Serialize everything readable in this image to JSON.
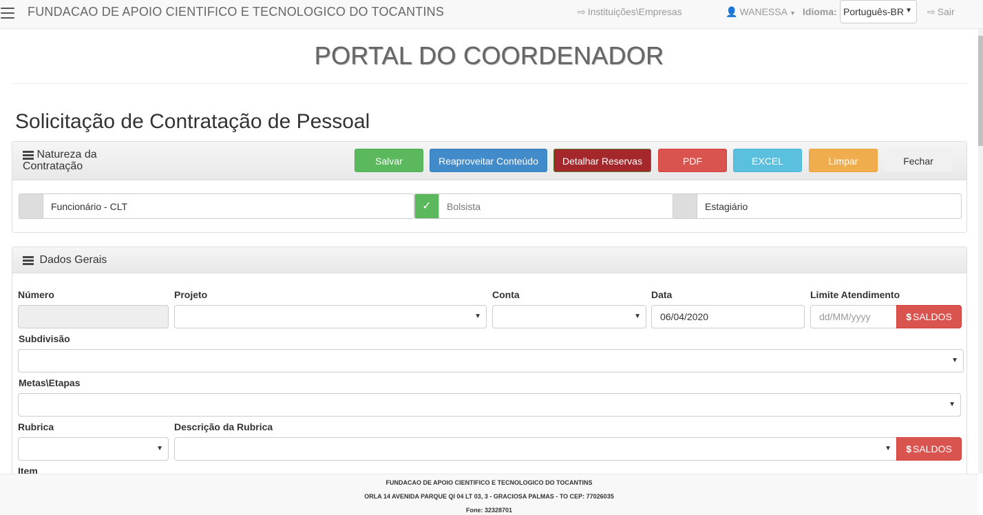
{
  "navbar": {
    "brand": "FUNDACAO DE APOIO CIENTIFICO E TECNOLOGICO DO TOCANTINS",
    "instituicoes": "Instituições\\Empresas",
    "user": "WANESSA",
    "idioma_label": "Idioma:",
    "idioma_value": "Português-BR",
    "sair": "Sair"
  },
  "header": {
    "title": "PORTAL DO COORDENADOR"
  },
  "section_title": "Solicitação de Contratação de Pessoal",
  "natureza": {
    "heading": "Natureza da Contratação",
    "buttons": {
      "salvar": "Salvar",
      "reaproveitar": "Reaproveitar Conteúdo",
      "detalhar": "Detalhar Reservas",
      "pdf": "PDF",
      "excel": "EXCEL",
      "limpar": "Limpar",
      "fechar": "Fechar"
    },
    "options": [
      {
        "label": "Funcionário - CLT",
        "checked": false
      },
      {
        "label": "Bolsista",
        "checked": true
      },
      {
        "label": "Estagiário",
        "checked": false
      }
    ]
  },
  "dados_gerais": {
    "heading": "Dados Gerais",
    "numero_label": "Número",
    "numero_value": "",
    "projeto_label": "Projeto",
    "projeto_value": "",
    "conta_label": "Conta",
    "conta_value": "",
    "data_label": "Data",
    "data_value": "06/04/2020",
    "limite_label": "Limite Atendimento",
    "limite_placeholder": "dd/MM/yyyy",
    "saldos_label": "SALDOS",
    "subdivisao_label": "Subdivisão",
    "metas_label": "Metas\\Etapas",
    "rubrica_label": "Rubrica",
    "descricao_label": "Descrição da Rubrica",
    "item_label": "Item"
  },
  "icons": {
    "check": "✓",
    "dropdown": "▼",
    "dollar": "$"
  },
  "footer": {
    "line1": "FUNDACAO DE APOIO CIENTIFICO E TECNOLOGICO DO TOCANTINS",
    "line2": "ORLA 14 AVENIDA PARQUE QI 04 LT 03, 3 - GRACIOSA PALMAS - TO CEP: 77026035",
    "line3": "Fone: 32328701"
  }
}
